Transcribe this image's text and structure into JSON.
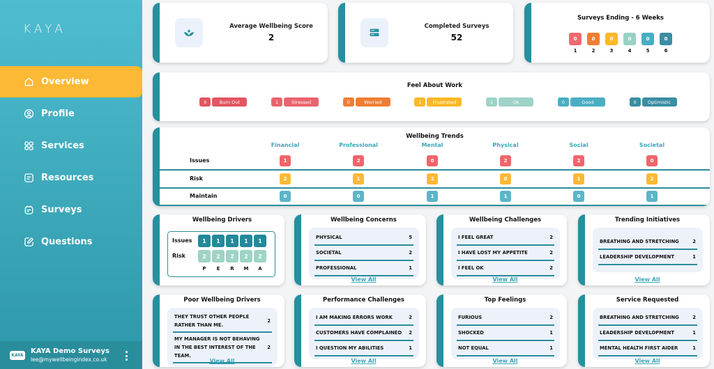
{
  "sidebar": {
    "logo": "KAYA",
    "items": [
      {
        "label": "Overview",
        "icon": "home-icon",
        "active": true
      },
      {
        "label": "Profile",
        "icon": "user-circle-icon",
        "active": false
      },
      {
        "label": "Services",
        "icon": "grid-icon",
        "active": false
      },
      {
        "label": "Resources",
        "icon": "document-icon",
        "active": false
      },
      {
        "label": "Surveys",
        "icon": "clipboard-icon",
        "active": false
      },
      {
        "label": "Questions",
        "icon": "edit-icon",
        "active": false
      }
    ],
    "user": {
      "logo_text": "KAYA",
      "name": "KAYA Demo Surveys",
      "email": "lee@mywellbeingindex.co.uk"
    }
  },
  "stats": {
    "avg_wellbeing": {
      "label": "Average Wellbeing Score",
      "value": "2",
      "icon": "lotus-icon"
    },
    "completed": {
      "label": "Completed Surveys",
      "value": "52",
      "icon": "server-icon"
    }
  },
  "surveys_ending": {
    "title": "Surveys Ending - 6 Weeks",
    "weeks": [
      {
        "week": "1",
        "count": "0",
        "color": "#ec6a6f"
      },
      {
        "week": "2",
        "count": "0",
        "color": "#ef7d33"
      },
      {
        "week": "3",
        "count": "0",
        "color": "#fbb927"
      },
      {
        "week": "4",
        "count": "0",
        "color": "#98d2c5"
      },
      {
        "week": "5",
        "count": "0",
        "color": "#4aaec3"
      },
      {
        "week": "6",
        "count": "0",
        "color": "#3a8ea2"
      }
    ]
  },
  "feel_about_work": {
    "title": "Feel About Work",
    "items": [
      {
        "count": "0",
        "label": "Burn Out",
        "color": "#e25561"
      },
      {
        "count": "1",
        "label": "Stressed",
        "color": "#e9646d"
      },
      {
        "count": "0",
        "label": "Worried",
        "color": "#ef7d33"
      },
      {
        "count": "1",
        "label": "Frustrated",
        "color": "#fbb927"
      },
      {
        "count": "1",
        "label": "Ok",
        "color": "#9fd3c7"
      },
      {
        "count": "0",
        "label": "Good",
        "color": "#4aaec3"
      },
      {
        "count": "0",
        "label": "Optimistic",
        "color": "#3a8ea2"
      }
    ]
  },
  "wellbeing_trends": {
    "title": "Wellbeing Trends",
    "columns": [
      "Financial",
      "Professional",
      "Mental",
      "Physical",
      "Social",
      "Societal"
    ],
    "rows": [
      {
        "label": "Issues",
        "color": "#f0656b",
        "values": [
          "1",
          "2",
          "0",
          "2",
          "2",
          "0"
        ]
      },
      {
        "label": "Risk",
        "color": "#fbb935",
        "values": [
          "2",
          "1",
          "2",
          "0",
          "1",
          "2"
        ]
      },
      {
        "label": "Maintain",
        "color": "#5ab6c8",
        "values": [
          "0",
          "0",
          "1",
          "1",
          "0",
          "1"
        ]
      }
    ]
  },
  "wellbeing_drivers": {
    "title": "Wellbeing Drivers",
    "rows": [
      {
        "label": "Issues",
        "color": "#23899a",
        "values": [
          "1",
          "1",
          "1",
          "1",
          "1"
        ]
      },
      {
        "label": "Risk",
        "color": "#9fd3c7",
        "values": [
          "2",
          "2",
          "2",
          "2",
          "2"
        ]
      }
    ],
    "letters": [
      "P",
      "E",
      "R",
      "M",
      "A"
    ]
  },
  "lists": {
    "view_all": "View All",
    "wellbeing_concerns": {
      "title": "Wellbeing Concerns",
      "items": [
        {
          "label": "PHYSICAL",
          "value": "5"
        },
        {
          "label": "SOCIETAL",
          "value": "2"
        },
        {
          "label": "PROFESSIONAL",
          "value": "1"
        }
      ]
    },
    "wellbeing_challenges": {
      "title": "Wellbeing Challenges",
      "items": [
        {
          "label": "I FEEL GREAT",
          "value": "2"
        },
        {
          "label": "I HAVE LOST MY APPETITE",
          "value": "2"
        },
        {
          "label": "I FEEL OK",
          "value": "2"
        }
      ]
    },
    "trending_initiatives": {
      "title": "Trending Initiatives",
      "items": [
        {
          "label": "BREATHING AND STRETCHING",
          "value": "2"
        },
        {
          "label": "LEADERSHIP DEVELOPMENT",
          "value": "1"
        }
      ]
    },
    "poor_wellbeing_drivers": {
      "title": "Poor Wellbeing Drivers",
      "items": [
        {
          "label": "THEY TRUST OTHER PEOPLE RATHER THAN ME.",
          "value": "2"
        },
        {
          "label": "MY MANAGER IS NOT BEHAVING IN THE BEST INTEREST OF THE TEAM.",
          "value": "2"
        }
      ]
    },
    "performance_challenges": {
      "title": "Performance Challenges",
      "items": [
        {
          "label": "I AM MAKING ERRORS WORK",
          "value": "2"
        },
        {
          "label": "CUSTOMERS HAVE COMPLAINED",
          "value": "2"
        },
        {
          "label": "I QUESTION MY ABILITIES",
          "value": "1"
        }
      ]
    },
    "top_feelings": {
      "title": "Top Feelings",
      "items": [
        {
          "label": "FURIOUS",
          "value": "2"
        },
        {
          "label": "SHOCKED",
          "value": "1"
        },
        {
          "label": "NOT EQUAL",
          "value": "1"
        }
      ]
    },
    "service_requested": {
      "title": "Service Requested",
      "items": [
        {
          "label": "BREATHING AND STRETCHING",
          "value": "2"
        },
        {
          "label": "LEADERSHIP DEVELOPMENT",
          "value": "1"
        },
        {
          "label": "MENTAL HEALTH FIRST AIDER",
          "value": "1"
        }
      ]
    }
  }
}
